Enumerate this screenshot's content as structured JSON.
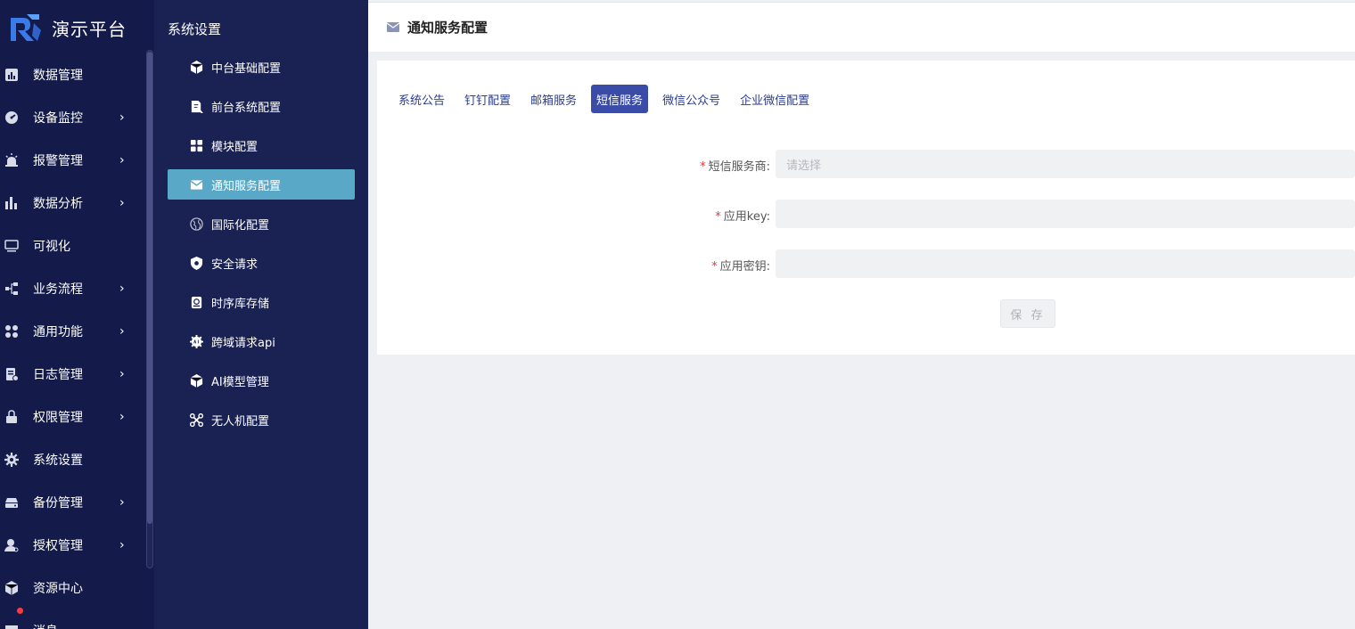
{
  "app": {
    "title": "演示平台"
  },
  "primary_menu": [
    {
      "label": "数据管理",
      "icon": "bar-chart-icon",
      "has_children": false
    },
    {
      "label": "设备监控",
      "icon": "gauge-icon",
      "has_children": true
    },
    {
      "label": "报警管理",
      "icon": "alarm-icon",
      "has_children": true
    },
    {
      "label": "数据分析",
      "icon": "analytics-icon",
      "has_children": true
    },
    {
      "label": "可视化",
      "icon": "monitor-icon",
      "has_children": false
    },
    {
      "label": "业务流程",
      "icon": "flow-icon",
      "has_children": true
    },
    {
      "label": "通用功能",
      "icon": "apps-icon",
      "has_children": true
    },
    {
      "label": "日志管理",
      "icon": "log-icon",
      "has_children": true
    },
    {
      "label": "权限管理",
      "icon": "lock-icon",
      "has_children": true
    },
    {
      "label": "系统设置",
      "icon": "gear-icon",
      "has_children": false
    },
    {
      "label": "备份管理",
      "icon": "server-icon",
      "has_children": true
    },
    {
      "label": "授权管理",
      "icon": "user-key-icon",
      "has_children": true
    },
    {
      "label": "资源中心",
      "icon": "cube-icon",
      "has_children": false
    },
    {
      "label": "消息",
      "icon": "message-icon",
      "has_children": false
    }
  ],
  "secondary": {
    "title": "系统设置",
    "items": [
      {
        "label": "中台基础配置",
        "icon": "cube-icon",
        "active": false
      },
      {
        "label": "前台系统配置",
        "icon": "document-icon",
        "active": false
      },
      {
        "label": "模块配置",
        "icon": "grid-icon",
        "active": false
      },
      {
        "label": "通知服务配置",
        "icon": "mail-icon",
        "active": true
      },
      {
        "label": "国际化配置",
        "icon": "globe-icon",
        "active": false
      },
      {
        "label": "安全请求",
        "icon": "shield-icon",
        "active": false
      },
      {
        "label": "时序库存储",
        "icon": "database-icon",
        "active": false
      },
      {
        "label": "跨域请求api",
        "icon": "api-icon",
        "active": false
      },
      {
        "label": "AI模型管理",
        "icon": "cube-icon",
        "active": false
      },
      {
        "label": "无人机配置",
        "icon": "drone-icon",
        "active": false
      }
    ]
  },
  "header": {
    "title": "通知服务配置",
    "icon": "mail-icon"
  },
  "tabs": [
    {
      "label": "系统公告",
      "active": false
    },
    {
      "label": "钉钉配置",
      "active": false
    },
    {
      "label": "邮箱服务",
      "active": false
    },
    {
      "label": "短信服务",
      "active": true
    },
    {
      "label": "微信公众号",
      "active": false
    },
    {
      "label": "企业微信配置",
      "active": false
    }
  ],
  "form": {
    "provider": {
      "label": "短信服务商",
      "placeholder": "请选择",
      "required": true
    },
    "app_key": {
      "label": "应用key",
      "value": "",
      "required": true
    },
    "app_secret": {
      "label": "应用密钥",
      "value": "",
      "required": true
    },
    "save_label": "保 存"
  },
  "colors": {
    "sidebar_primary": "#141b4a",
    "sidebar_secondary": "#1a2254",
    "active_item": "#5aa8c8",
    "active_tab": "#3b4ca8",
    "required_star": "#e53935"
  }
}
